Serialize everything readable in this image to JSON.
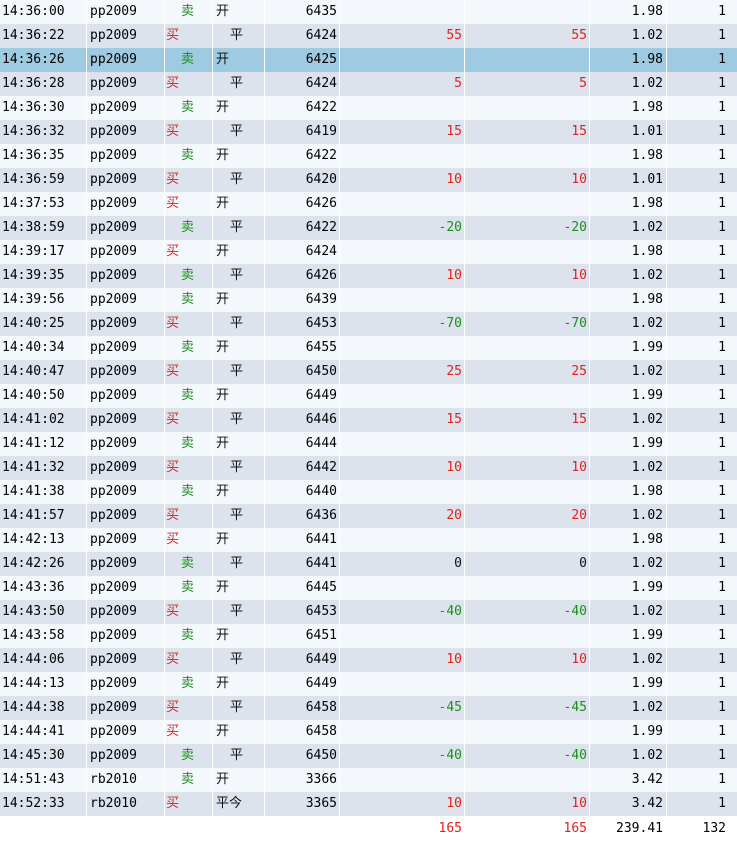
{
  "trade_rows": [
    {
      "time": "14:36:00",
      "symbol": "pp2009",
      "side": "卖",
      "openclose": "开",
      "price": "6435",
      "pl1": "",
      "pl2": "",
      "fee": "1.98",
      "qty": "1"
    },
    {
      "time": "14:36:22",
      "symbol": "pp2009",
      "side": "买",
      "openclose": "平",
      "price": "6424",
      "pl1": "55",
      "pl2": "55",
      "fee": "1.02",
      "qty": "1"
    },
    {
      "time": "14:36:26",
      "symbol": "pp2009",
      "side": "卖",
      "openclose": "开",
      "price": "6425",
      "pl1": "",
      "pl2": "",
      "fee": "1.98",
      "qty": "1",
      "selected": true
    },
    {
      "time": "14:36:28",
      "symbol": "pp2009",
      "side": "买",
      "openclose": "平",
      "price": "6424",
      "pl1": "5",
      "pl2": "5",
      "fee": "1.02",
      "qty": "1"
    },
    {
      "time": "14:36:30",
      "symbol": "pp2009",
      "side": "卖",
      "openclose": "开",
      "price": "6422",
      "pl1": "",
      "pl2": "",
      "fee": "1.98",
      "qty": "1"
    },
    {
      "time": "14:36:32",
      "symbol": "pp2009",
      "side": "买",
      "openclose": "平",
      "price": "6419",
      "pl1": "15",
      "pl2": "15",
      "fee": "1.01",
      "qty": "1"
    },
    {
      "time": "14:36:35",
      "symbol": "pp2009",
      "side": "卖",
      "openclose": "开",
      "price": "6422",
      "pl1": "",
      "pl2": "",
      "fee": "1.98",
      "qty": "1"
    },
    {
      "time": "14:36:59",
      "symbol": "pp2009",
      "side": "买",
      "openclose": "平",
      "price": "6420",
      "pl1": "10",
      "pl2": "10",
      "fee": "1.01",
      "qty": "1"
    },
    {
      "time": "14:37:53",
      "symbol": "pp2009",
      "side": "买",
      "openclose": "开",
      "price": "6426",
      "pl1": "",
      "pl2": "",
      "fee": "1.98",
      "qty": "1"
    },
    {
      "time": "14:38:59",
      "symbol": "pp2009",
      "side": "卖",
      "openclose": "平",
      "price": "6422",
      "pl1": "-20",
      "pl2": "-20",
      "fee": "1.02",
      "qty": "1"
    },
    {
      "time": "14:39:17",
      "symbol": "pp2009",
      "side": "买",
      "openclose": "开",
      "price": "6424",
      "pl1": "",
      "pl2": "",
      "fee": "1.98",
      "qty": "1"
    },
    {
      "time": "14:39:35",
      "symbol": "pp2009",
      "side": "卖",
      "openclose": "平",
      "price": "6426",
      "pl1": "10",
      "pl2": "10",
      "fee": "1.02",
      "qty": "1"
    },
    {
      "time": "14:39:56",
      "symbol": "pp2009",
      "side": "卖",
      "openclose": "开",
      "price": "6439",
      "pl1": "",
      "pl2": "",
      "fee": "1.98",
      "qty": "1"
    },
    {
      "time": "14:40:25",
      "symbol": "pp2009",
      "side": "买",
      "openclose": "平",
      "price": "6453",
      "pl1": "-70",
      "pl2": "-70",
      "fee": "1.02",
      "qty": "1"
    },
    {
      "time": "14:40:34",
      "symbol": "pp2009",
      "side": "卖",
      "openclose": "开",
      "price": "6455",
      "pl1": "",
      "pl2": "",
      "fee": "1.99",
      "qty": "1"
    },
    {
      "time": "14:40:47",
      "symbol": "pp2009",
      "side": "买",
      "openclose": "平",
      "price": "6450",
      "pl1": "25",
      "pl2": "25",
      "fee": "1.02",
      "qty": "1"
    },
    {
      "time": "14:40:50",
      "symbol": "pp2009",
      "side": "卖",
      "openclose": "开",
      "price": "6449",
      "pl1": "",
      "pl2": "",
      "fee": "1.99",
      "qty": "1"
    },
    {
      "time": "14:41:02",
      "symbol": "pp2009",
      "side": "买",
      "openclose": "平",
      "price": "6446",
      "pl1": "15",
      "pl2": "15",
      "fee": "1.02",
      "qty": "1"
    },
    {
      "time": "14:41:12",
      "symbol": "pp2009",
      "side": "卖",
      "openclose": "开",
      "price": "6444",
      "pl1": "",
      "pl2": "",
      "fee": "1.99",
      "qty": "1"
    },
    {
      "time": "14:41:32",
      "symbol": "pp2009",
      "side": "买",
      "openclose": "平",
      "price": "6442",
      "pl1": "10",
      "pl2": "10",
      "fee": "1.02",
      "qty": "1"
    },
    {
      "time": "14:41:38",
      "symbol": "pp2009",
      "side": "卖",
      "openclose": "开",
      "price": "6440",
      "pl1": "",
      "pl2": "",
      "fee": "1.98",
      "qty": "1"
    },
    {
      "time": "14:41:57",
      "symbol": "pp2009",
      "side": "买",
      "openclose": "平",
      "price": "6436",
      "pl1": "20",
      "pl2": "20",
      "fee": "1.02",
      "qty": "1"
    },
    {
      "time": "14:42:13",
      "symbol": "pp2009",
      "side": "买",
      "openclose": "开",
      "price": "6441",
      "pl1": "",
      "pl2": "",
      "fee": "1.98",
      "qty": "1"
    },
    {
      "time": "14:42:26",
      "symbol": "pp2009",
      "side": "卖",
      "openclose": "平",
      "price": "6441",
      "pl1": "0",
      "pl2": "0",
      "fee": "1.02",
      "qty": "1"
    },
    {
      "time": "14:43:36",
      "symbol": "pp2009",
      "side": "卖",
      "openclose": "开",
      "price": "6445",
      "pl1": "",
      "pl2": "",
      "fee": "1.99",
      "qty": "1"
    },
    {
      "time": "14:43:50",
      "symbol": "pp2009",
      "side": "买",
      "openclose": "平",
      "price": "6453",
      "pl1": "-40",
      "pl2": "-40",
      "fee": "1.02",
      "qty": "1"
    },
    {
      "time": "14:43:58",
      "symbol": "pp2009",
      "side": "卖",
      "openclose": "开",
      "price": "6451",
      "pl1": "",
      "pl2": "",
      "fee": "1.99",
      "qty": "1"
    },
    {
      "time": "14:44:06",
      "symbol": "pp2009",
      "side": "买",
      "openclose": "平",
      "price": "6449",
      "pl1": "10",
      "pl2": "10",
      "fee": "1.02",
      "qty": "1"
    },
    {
      "time": "14:44:13",
      "symbol": "pp2009",
      "side": "卖",
      "openclose": "开",
      "price": "6449",
      "pl1": "",
      "pl2": "",
      "fee": "1.99",
      "qty": "1"
    },
    {
      "time": "14:44:38",
      "symbol": "pp2009",
      "side": "买",
      "openclose": "平",
      "price": "6458",
      "pl1": "-45",
      "pl2": "-45",
      "fee": "1.02",
      "qty": "1"
    },
    {
      "time": "14:44:41",
      "symbol": "pp2009",
      "side": "买",
      "openclose": "开",
      "price": "6458",
      "pl1": "",
      "pl2": "",
      "fee": "1.99",
      "qty": "1"
    },
    {
      "time": "14:45:30",
      "symbol": "pp2009",
      "side": "卖",
      "openclose": "平",
      "price": "6450",
      "pl1": "-40",
      "pl2": "-40",
      "fee": "1.02",
      "qty": "1"
    },
    {
      "time": "14:51:43",
      "symbol": "rb2010",
      "side": "卖",
      "openclose": "开",
      "price": "3366",
      "pl1": "",
      "pl2": "",
      "fee": "3.42",
      "qty": "1"
    },
    {
      "time": "14:52:33",
      "symbol": "rb2010",
      "side": "买",
      "openclose": "平今",
      "price": "3365",
      "pl1": "10",
      "pl2": "10",
      "fee": "3.42",
      "qty": "1"
    }
  ],
  "totals": {
    "pl1": "165",
    "pl2": "165",
    "fee": "239.41",
    "qty": "132"
  },
  "colors": {
    "buy": "#e0201c",
    "sell": "#1a8f1a",
    "row_odd": "#f4f7fc",
    "row_even": "#dde3ec",
    "row_selected": "#9ecae2"
  }
}
